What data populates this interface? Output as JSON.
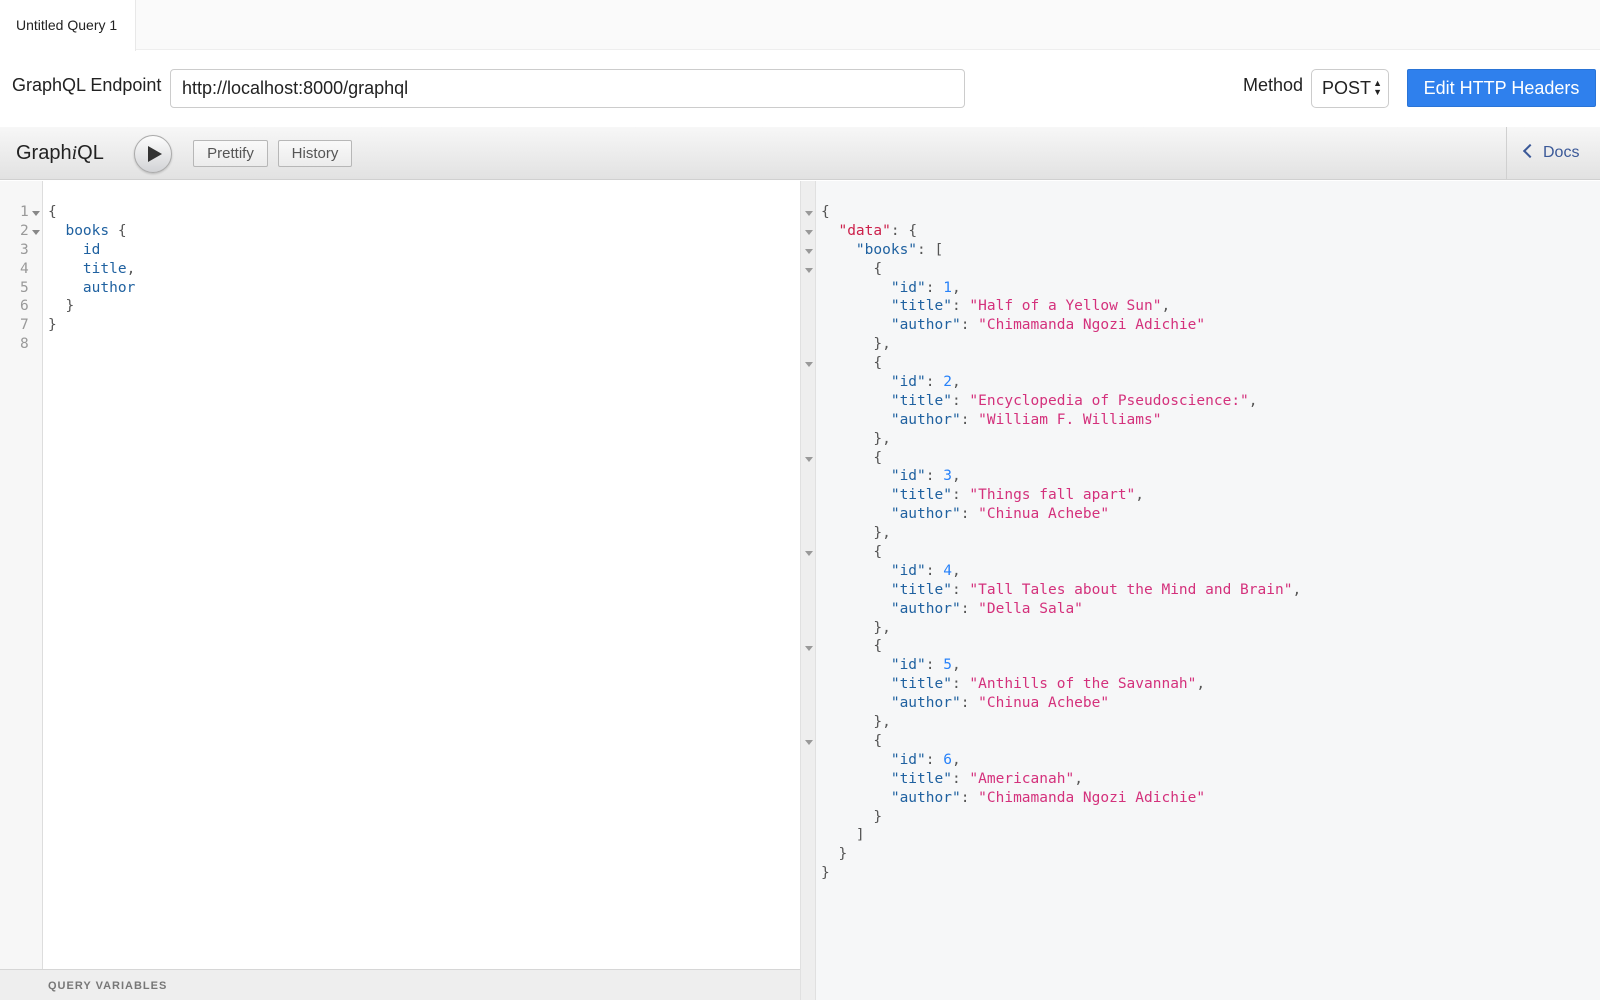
{
  "tabs": [
    {
      "label": "Untitled Query 1",
      "active": true
    }
  ],
  "endpoint": {
    "label": "GraphQL Endpoint",
    "value": "http://localhost:8000/graphql"
  },
  "method": {
    "label": "Method",
    "selected": "POST"
  },
  "headers_button": "Edit HTTP Headers",
  "toolbar": {
    "logo_pre": "Graph",
    "logo_i": "i",
    "logo_post": "QL",
    "prettify": "Prettify",
    "history": "History",
    "docs": "Docs"
  },
  "query": {
    "line_numbers": [
      "1",
      "2",
      "3",
      "4",
      "5",
      "6",
      "7",
      "8"
    ],
    "lines": [
      {
        "indent": "",
        "text": "{",
        "kind": "punct"
      },
      {
        "indent": "  ",
        "text": "books",
        "kind": "field",
        "suffix": " {"
      },
      {
        "indent": "    ",
        "text": "id",
        "kind": "field",
        "suffix": ""
      },
      {
        "indent": "    ",
        "text": "title",
        "kind": "field",
        "suffix": ","
      },
      {
        "indent": "    ",
        "text": "author",
        "kind": "field",
        "suffix": ""
      },
      {
        "indent": "  ",
        "text": "}",
        "kind": "punct"
      },
      {
        "indent": "",
        "text": "}",
        "kind": "punct"
      },
      {
        "indent": "",
        "text": "",
        "kind": "punct"
      }
    ],
    "variables_label": "QUERY VARIABLES"
  },
  "result": {
    "root_key": "data",
    "list_key": "books",
    "books": [
      {
        "id": 1,
        "title": "Half of a Yellow Sun",
        "author": "Chimamanda Ngozi Adichie"
      },
      {
        "id": 2,
        "title": "Encyclopedia of Pseudoscience:",
        "author": "William F. Williams"
      },
      {
        "id": 3,
        "title": "Things fall apart",
        "author": "Chinua Achebe"
      },
      {
        "id": 4,
        "title": "Tall Tales about the Mind and Brain",
        "author": "Della Sala"
      },
      {
        "id": 5,
        "title": "Anthills of the Savannah",
        "author": "Chinua Achebe"
      },
      {
        "id": 6,
        "title": "Americanah",
        "author": "Chimamanda Ngozi Adichie"
      }
    ]
  },
  "colors": {
    "accent": "#2f80ed",
    "json_key": "#1f61a0",
    "json_string": "#d4317c",
    "json_number": "#2882f9",
    "json_data_key": "#cc1f4a"
  }
}
